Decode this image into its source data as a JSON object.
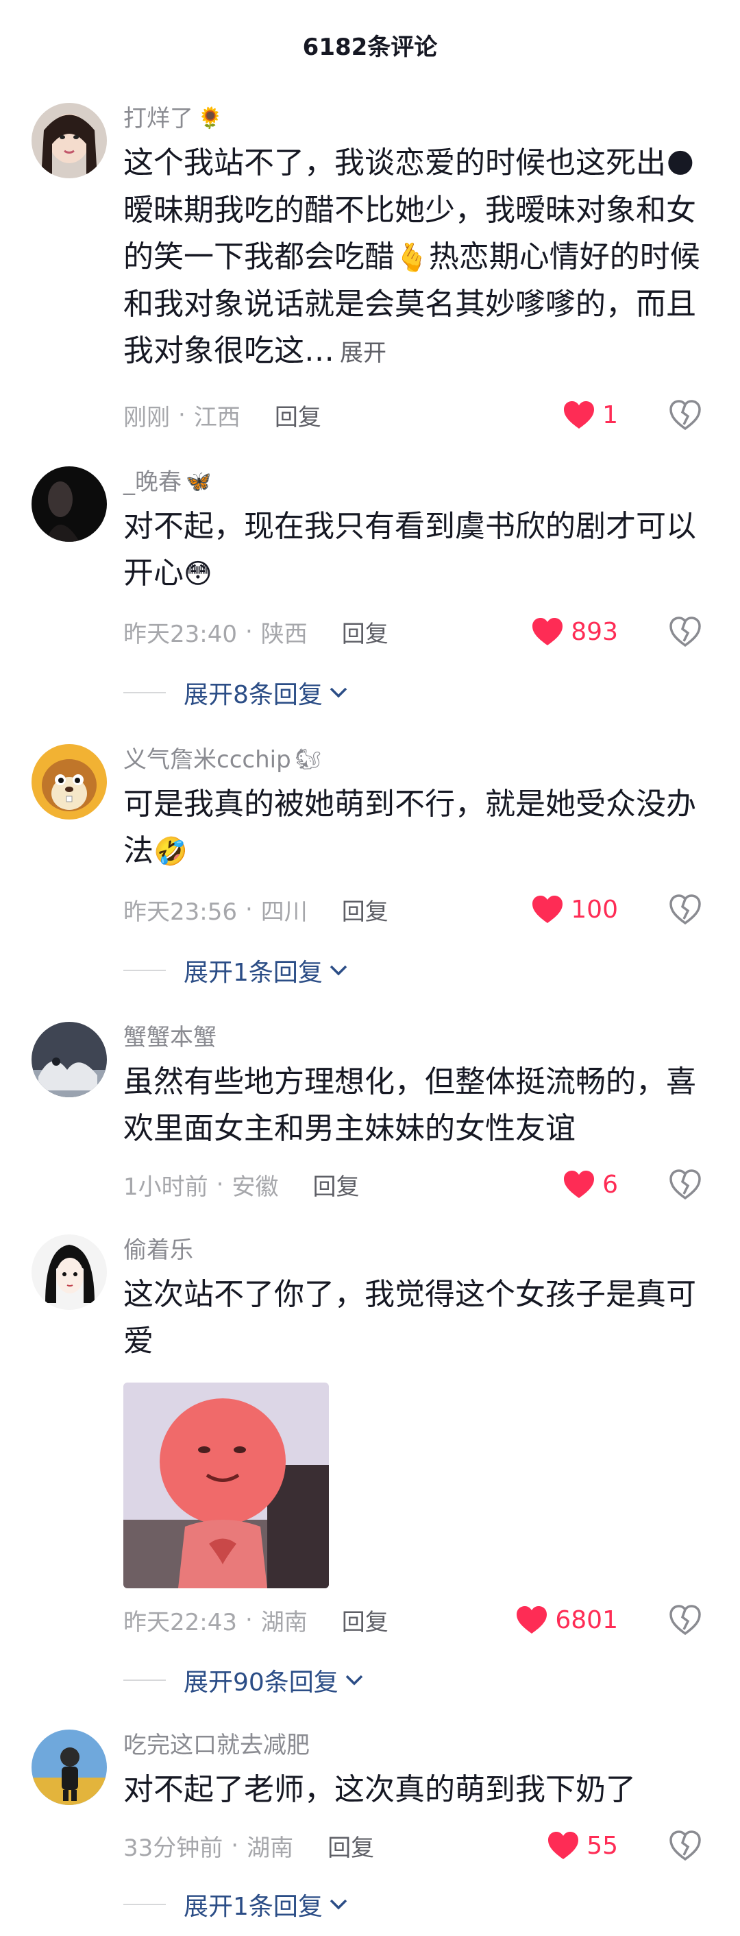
{
  "header": {
    "title": "6182条评论"
  },
  "reply_label": "回复",
  "comments": [
    {
      "username": "打烊了",
      "name_emoji": "🌻",
      "text_parts": [
        "这个我站不了，我谈恋爱的时候也这死出",
        "🌑",
        "暧昧期我吃的醋不比她少，我暧昧对象和女的笑一下我都会吃醋",
        "🫰",
        "热恋期心情好的时候和我对象说话就是会莫名其妙嗲嗲的，而且我对象很吃这…"
      ],
      "expand_text": "展开",
      "time": "刚刚",
      "location": "江西",
      "likes": "1",
      "like_color": "#fe2c55"
    },
    {
      "username": "_晚春",
      "name_emoji": "🦋",
      "text_parts": [
        "对不起，现在我只有看到虞书欣的剧才可以开心",
        "😳"
      ],
      "time": "昨天23:40",
      "location": "陕西",
      "likes": "893",
      "replies": "展开8条回复"
    },
    {
      "username": "义气詹米ccchip",
      "name_emoji": "🐿",
      "text_parts": [
        "可是我真的被她萌到不行，就是她受众没办法",
        "🤣"
      ],
      "time": "昨天23:56",
      "location": "四川",
      "likes": "100",
      "replies": "展开1条回复"
    },
    {
      "username": "蟹蟹本蟹",
      "text_parts": [
        "虽然有些地方理想化，但整体挺流畅的，喜欢里面女主和男主妹妹的女性友谊"
      ],
      "time": "1小时前",
      "location": "安徽",
      "likes": "6"
    },
    {
      "username": "偷着乐",
      "text_parts": [
        "这次站不了你了，我觉得这个女孩子是真可爱"
      ],
      "time": "昨天22:43",
      "location": "湖南",
      "likes": "6801",
      "replies": "展开90条回复"
    },
    {
      "username": "吃完这口就去减肥",
      "text_parts": [
        "对不起了老师，这次真的萌到我下奶了"
      ],
      "time": "33分钟前",
      "location": "湖南",
      "likes": "55",
      "replies": "展开1条回复"
    }
  ],
  "icons": {
    "like": "heart-icon",
    "dislike": "broken-heart-icon",
    "chevron": "chevron-down-icon"
  },
  "colors": {
    "accent": "#fe2c55",
    "link": "#2b4d86",
    "meta": "#a6a7ab"
  }
}
